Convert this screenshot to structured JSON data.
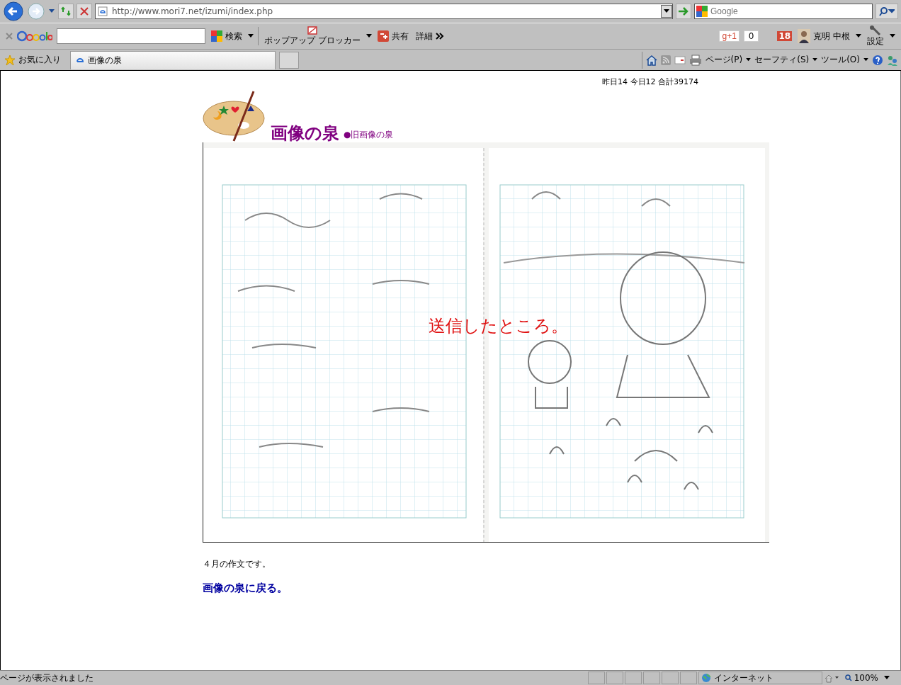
{
  "address_bar": {
    "url": "http://www.mori7.net/izumi/index.php",
    "search_placeholder": "Google"
  },
  "google_toolbar": {
    "search_button": "検索",
    "popup_blocker": "ポップアップ ブロッカー",
    "share": "共有",
    "more": "詳細",
    "plus_one": "g+1",
    "plus_count": "0",
    "notifications": "18",
    "user": "克明 中根",
    "settings": "設定"
  },
  "favorites_bar": {
    "favorites": "お気に入り",
    "tabs": [
      {
        "title": "画像の泉",
        "selected": true
      }
    ],
    "commands": [
      "ページ(P)",
      "セーフティ(S)",
      "ツール(O)"
    ]
  },
  "page": {
    "counter": "昨日14 今日12 合計39174",
    "title": "画像の泉",
    "old_link": "●旧画像の泉",
    "image": {
      "kind": "picture",
      "caption": "送信したところ。"
    },
    "description": "４月の作文です。",
    "back_link": "画像の泉に戻る。"
  },
  "status_bar": {
    "message": "ページが表示されました",
    "zone": "インターネット",
    "zoom": "100%"
  }
}
